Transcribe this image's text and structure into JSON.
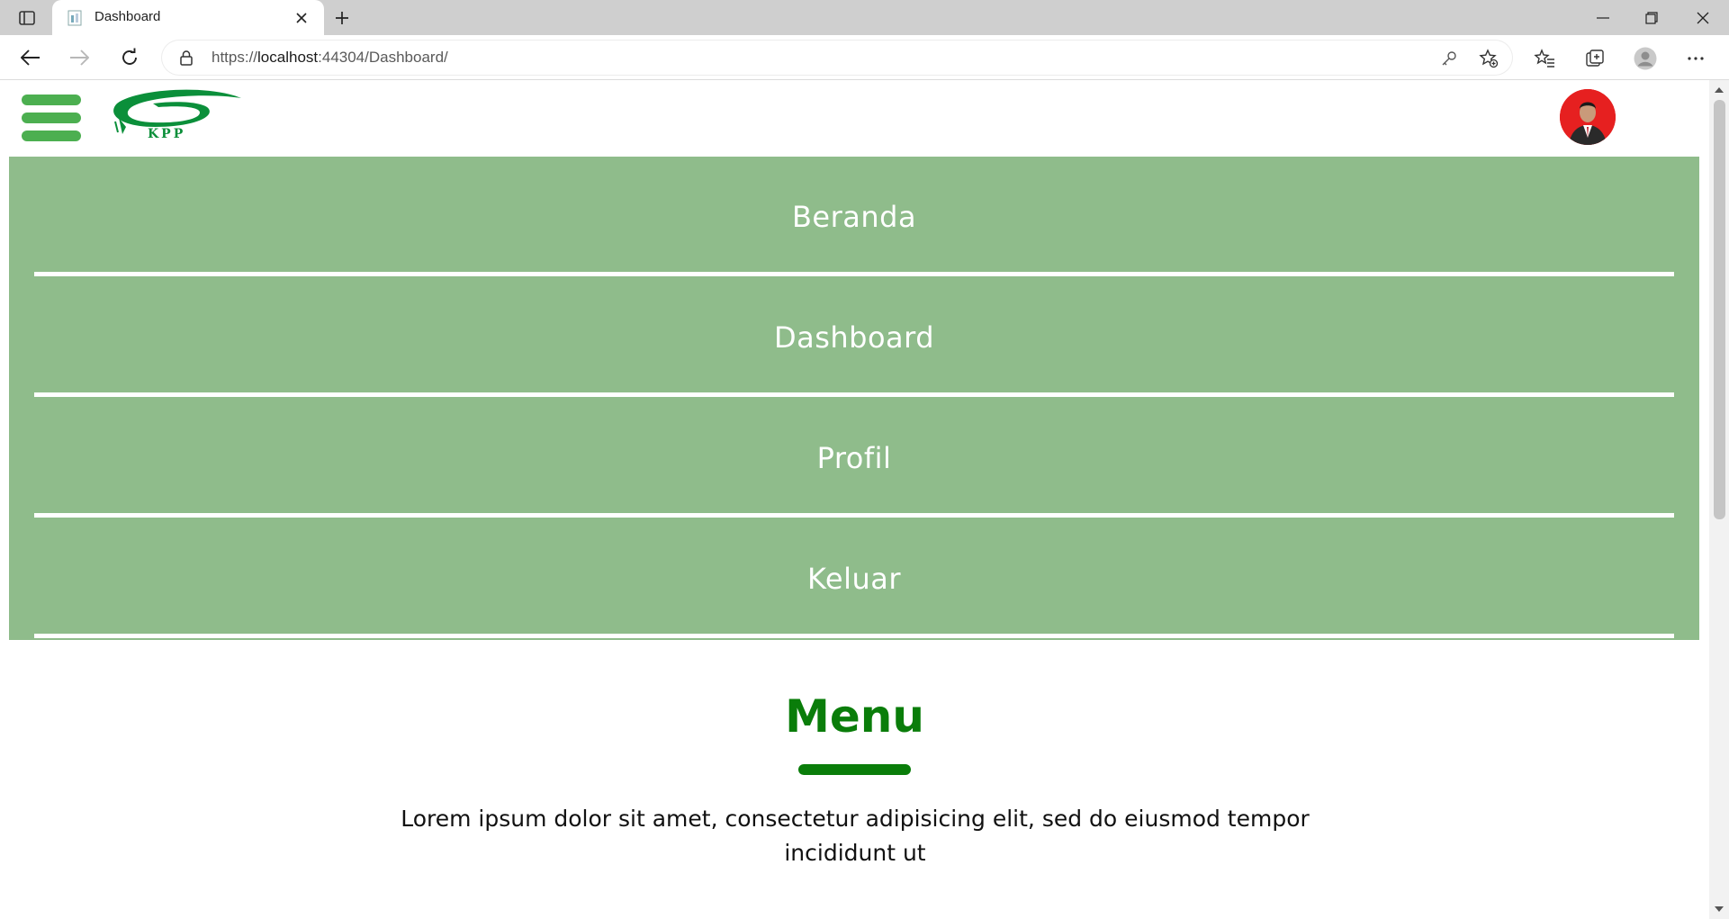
{
  "browser": {
    "tab_title": "Dashboard",
    "url_prefix": "https://",
    "url_host": "localhost",
    "url_rest": ":44304/Dashboard/"
  },
  "page": {
    "logo_text": "KPP",
    "nav_items": [
      {
        "label": "Beranda"
      },
      {
        "label": "Dashboard"
      },
      {
        "label": "Profil"
      },
      {
        "label": "Keluar"
      }
    ],
    "section_title": "Menu",
    "section_desc": "Lorem ipsum dolor sit amet, consectetur adipisicing elit, sed do eiusmod tempor incididunt ut"
  },
  "colors": {
    "menu_bg": "#8fbc8b",
    "accent_green": "#0a7d0a",
    "hamburger_green": "#4caf50",
    "avatar_bg": "#e62020"
  },
  "icons": {
    "tab_actions": "tab-actions-icon",
    "back": "back-arrow-icon",
    "forward": "forward-arrow-icon",
    "refresh": "refresh-icon",
    "lock": "lock-icon",
    "password": "key-icon",
    "add_favorite": "star-plus-icon",
    "favorites": "favorites-icon",
    "collections": "collections-icon",
    "profile": "profile-icon",
    "more": "more-icon"
  }
}
